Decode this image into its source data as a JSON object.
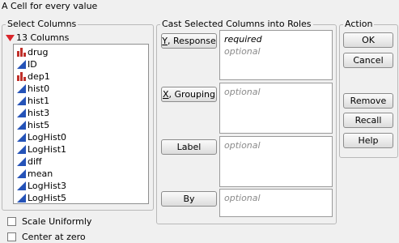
{
  "window": {
    "title": "A Cell for every value"
  },
  "select_columns": {
    "legend": "Select Columns",
    "count_label": "13 Columns",
    "columns": [
      {
        "name": "drug",
        "type": "nominal"
      },
      {
        "name": "ID",
        "type": "continuous"
      },
      {
        "name": "dep1",
        "type": "nominal"
      },
      {
        "name": "hist0",
        "type": "continuous"
      },
      {
        "name": "hist1",
        "type": "continuous"
      },
      {
        "name": "hist3",
        "type": "continuous"
      },
      {
        "name": "hist5",
        "type": "continuous"
      },
      {
        "name": "LogHist0",
        "type": "continuous"
      },
      {
        "name": "LogHist1",
        "type": "continuous"
      },
      {
        "name": "diff",
        "type": "continuous"
      },
      {
        "name": "mean",
        "type": "continuous"
      },
      {
        "name": "LogHist3",
        "type": "continuous"
      },
      {
        "name": "LogHist5",
        "type": "continuous"
      }
    ]
  },
  "roles": {
    "legend": "Cast Selected Columns into Roles",
    "y_response": {
      "mnemonic": "Y",
      "rest": ", Response",
      "required": "required",
      "optional": "optional"
    },
    "x_grouping": {
      "mnemonic": "X",
      "rest": ", Grouping",
      "optional": "optional"
    },
    "label": {
      "text": "Label",
      "optional": "optional"
    },
    "by": {
      "text": "By",
      "optional": "optional"
    }
  },
  "action": {
    "legend": "Action",
    "ok": "OK",
    "cancel": "Cancel",
    "remove": "Remove",
    "recall": "Recall",
    "help": "Help"
  },
  "options": {
    "scale_uniformly": {
      "label": "Scale Uniformly",
      "checked": false
    },
    "center_at_zero": {
      "label": "Center at zero",
      "checked": false
    }
  },
  "colors": {
    "nominal": "#c0302a",
    "continuous": "#2553b8",
    "disclosure": "#d9262b"
  }
}
